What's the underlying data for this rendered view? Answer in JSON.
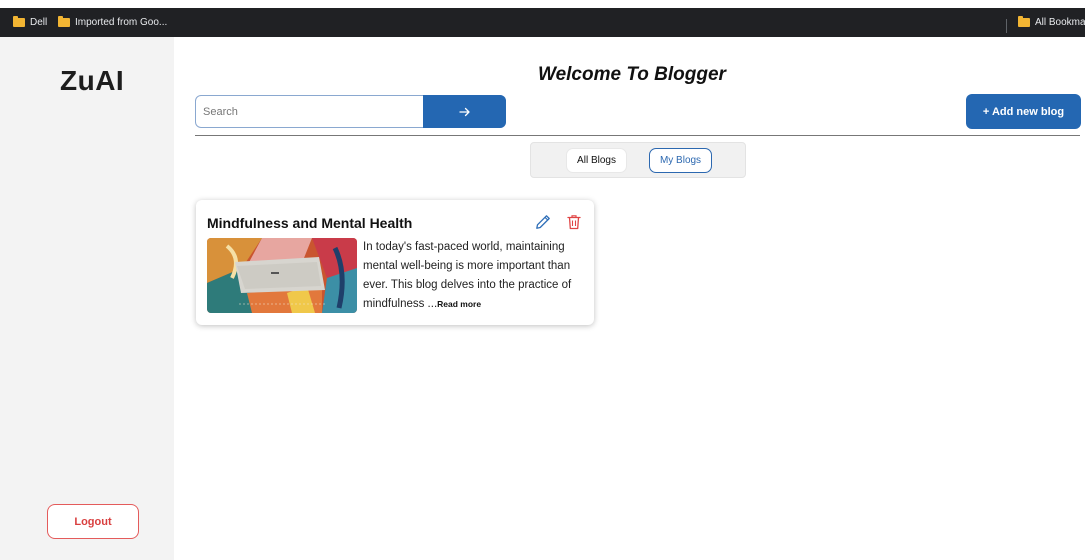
{
  "bookmarks": {
    "items": [
      {
        "label": "Dell",
        "icon": "folder-icon"
      },
      {
        "label": "Imported from Goo...",
        "icon": "folder-icon"
      }
    ],
    "all_bookmarks": "All Bookmarks"
  },
  "sidebar": {
    "logo": "ZuAI",
    "logout_label": "Logout"
  },
  "header": {
    "title": "Welcome To Blogger",
    "search_placeholder": "Search",
    "search_button_icon": "arrow-right-icon",
    "add_blog_label": "+ Add new blog"
  },
  "tabs": [
    {
      "label": "All Blogs",
      "selected": false
    },
    {
      "label": "My Blogs",
      "selected": true
    }
  ],
  "blogs": [
    {
      "title": "Mindfulness and Mental Health",
      "excerpt": "In today's fast-paced world, maintaining mental well-being is more important than ever. This blog delves into the practice of mindfulness ...",
      "read_more": "Read more",
      "actions": [
        "edit-icon",
        "delete-icon"
      ]
    }
  ],
  "colors": {
    "primary": "#2467b2",
    "danger": "#d93f3f",
    "sidebar_bg": "#f3f3f3",
    "bookmarks_bg": "#202124"
  }
}
